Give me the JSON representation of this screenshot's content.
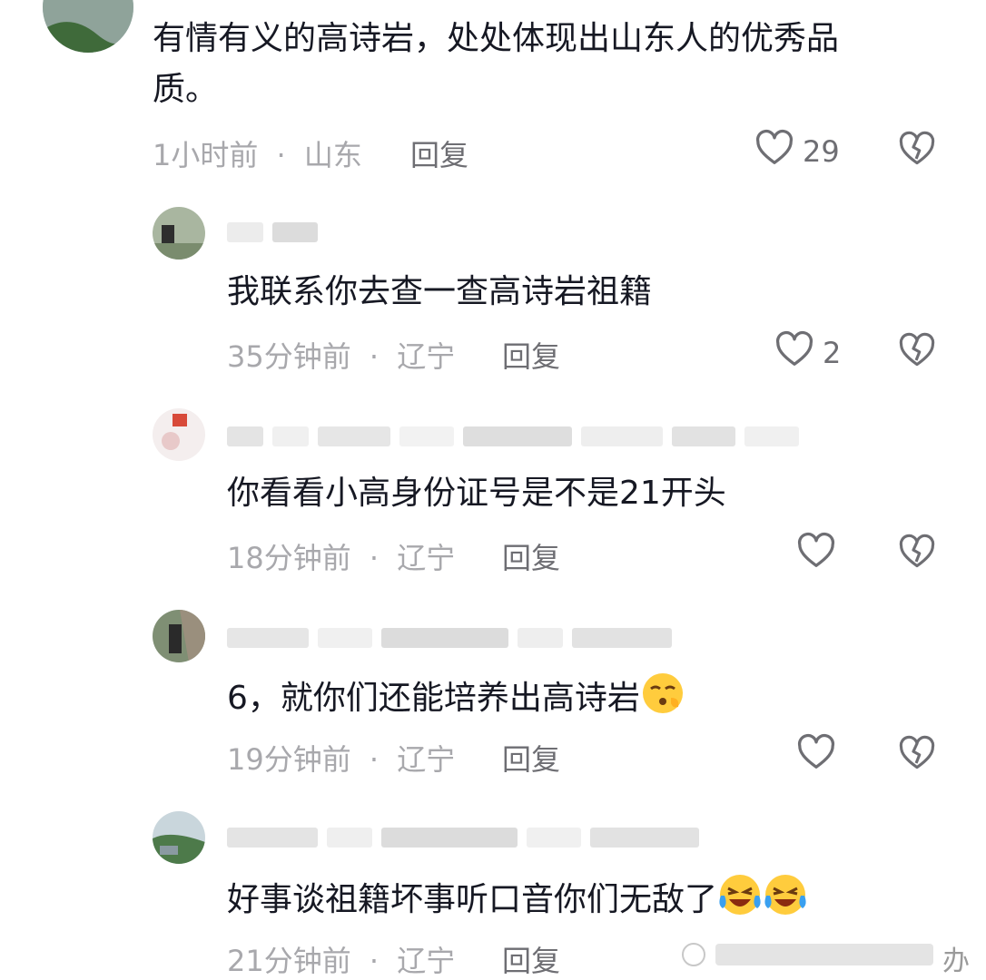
{
  "comments": [
    {
      "id": "c1",
      "text_line1": "有情有义的高诗岩，处处体现出山东人的优秀品",
      "text_line2": "质。",
      "time": "1小时前",
      "location": "山东",
      "reply_label": "回复",
      "likes": "29"
    }
  ],
  "replies": [
    {
      "text": "我联系你去查一查高诗岩祖籍",
      "time": "35分钟前",
      "location": "辽宁",
      "reply_label": "回复",
      "likes": "2"
    },
    {
      "text": "你看看小高身份证号是不是21开头",
      "time": "18分钟前",
      "location": "辽宁",
      "reply_label": "回复",
      "likes": ""
    },
    {
      "text": "6，就你们还能培养出高诗岩",
      "emoji": "sleepy-face",
      "time": "19分钟前",
      "location": "辽宁",
      "reply_label": "回复",
      "likes": ""
    },
    {
      "text": "好事谈祖籍坏事听口音你们无敌了",
      "emoji": "crying-laughing-face",
      "time": "21分钟前",
      "location": "辽宁",
      "reply_label": "回复",
      "likes": ""
    }
  ],
  "separator": "·",
  "watermark": "办",
  "icons": {
    "like": "heart-outline-icon",
    "dislike": "broken-heart-icon"
  },
  "colors": {
    "text": "#161823",
    "meta": "#a8a8ac",
    "icon": "#6e6e73"
  }
}
